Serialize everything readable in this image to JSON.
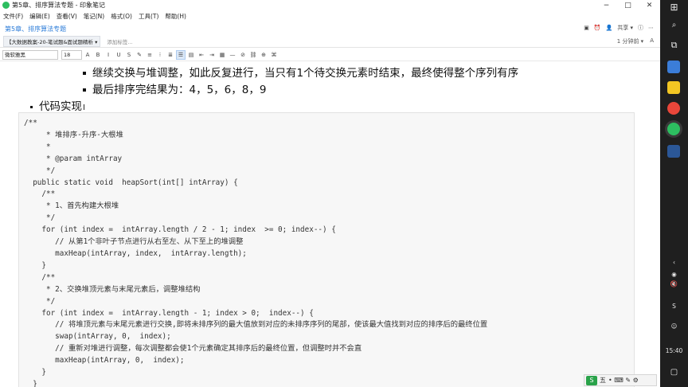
{
  "window": {
    "title": "第5章、排序算法专题 - 印象笔记",
    "minimize_label": "−",
    "maximize_label": "□",
    "close_label": "✕"
  },
  "menu": [
    "文件(F)",
    "编辑(E)",
    "查看(V)",
    "笔记(N)",
    "格式(O)",
    "工具(T)",
    "帮助(H)"
  ],
  "note": {
    "title": "第5章、排序算法专题",
    "share_label": "共享 ▾",
    "notebook": "【大数据教案-20-笔试题&面试题精析 ▾",
    "add_tag": "添加标签...",
    "time_ago": "1 分钟前 ▾"
  },
  "toolbar": {
    "font_family": "微软雅黑",
    "font_size": "18",
    "icons": [
      "A",
      "B",
      "I",
      "U",
      "S",
      "✎",
      "≡",
      "⁝",
      "≣",
      "☰",
      "▤",
      "⇤",
      "⇥",
      "▦",
      "—",
      "⊘",
      "⛓",
      "⊕",
      "⌘"
    ]
  },
  "content": {
    "bullets": [
      "继续交换与堆调整，如此反复进行，当只有1个待交换元素时结束，最终使得整个序列有序",
      "最后排序完结果为：4，5，6，8，9"
    ],
    "section_heading": "代码实现",
    "code": "/**\n     * 堆排序-升序-大根堆\n     *\n     * @param intArray\n     */\n  public static void  heapSort(int[] intArray) {\n    /**\n     * 1、首先构建大根堆\n     */\n    for (int index =  intArray.length / 2 - 1; index  >= 0; index--) {\n       // 从第1个非叶子节点进行从右至左、从下至上的堆调整\n       maxHeap(intArray, index,  intArray.length);\n    }\n    /**\n     * 2、交换堆顶元素与末尾元素后，调整堆结构\n     */\n    for (int index =  intArray.length - 1; index > 0;  index--) {\n       // 将堆顶元素与末尾元素进行交换,即将未排序列的最大值放到对应的未排序序列的尾部，使该最大值找到对应的排序后的最终位置\n       swap(intArray, 0,  index);\n       // 重新对堆进行调整，每次调整都会使1个元素确定其排序后的最终位置，但调整时并不会直\n       maxHeap(intArray, 0,  index);\n    }\n  }"
  },
  "taskbar": {
    "clock": "15:40",
    "apps": [
      "chrome",
      "evernote",
      "word",
      "sticky-notes",
      "explorer"
    ]
  },
  "ime": {
    "logo": "S",
    "mode": "五",
    "symbols": "• ⌨ ✎ ⚙"
  },
  "colors": {
    "accent": "#2a7bd8",
    "evernote_green": "#2dbe60",
    "taskbar": "#1f1f1f"
  }
}
